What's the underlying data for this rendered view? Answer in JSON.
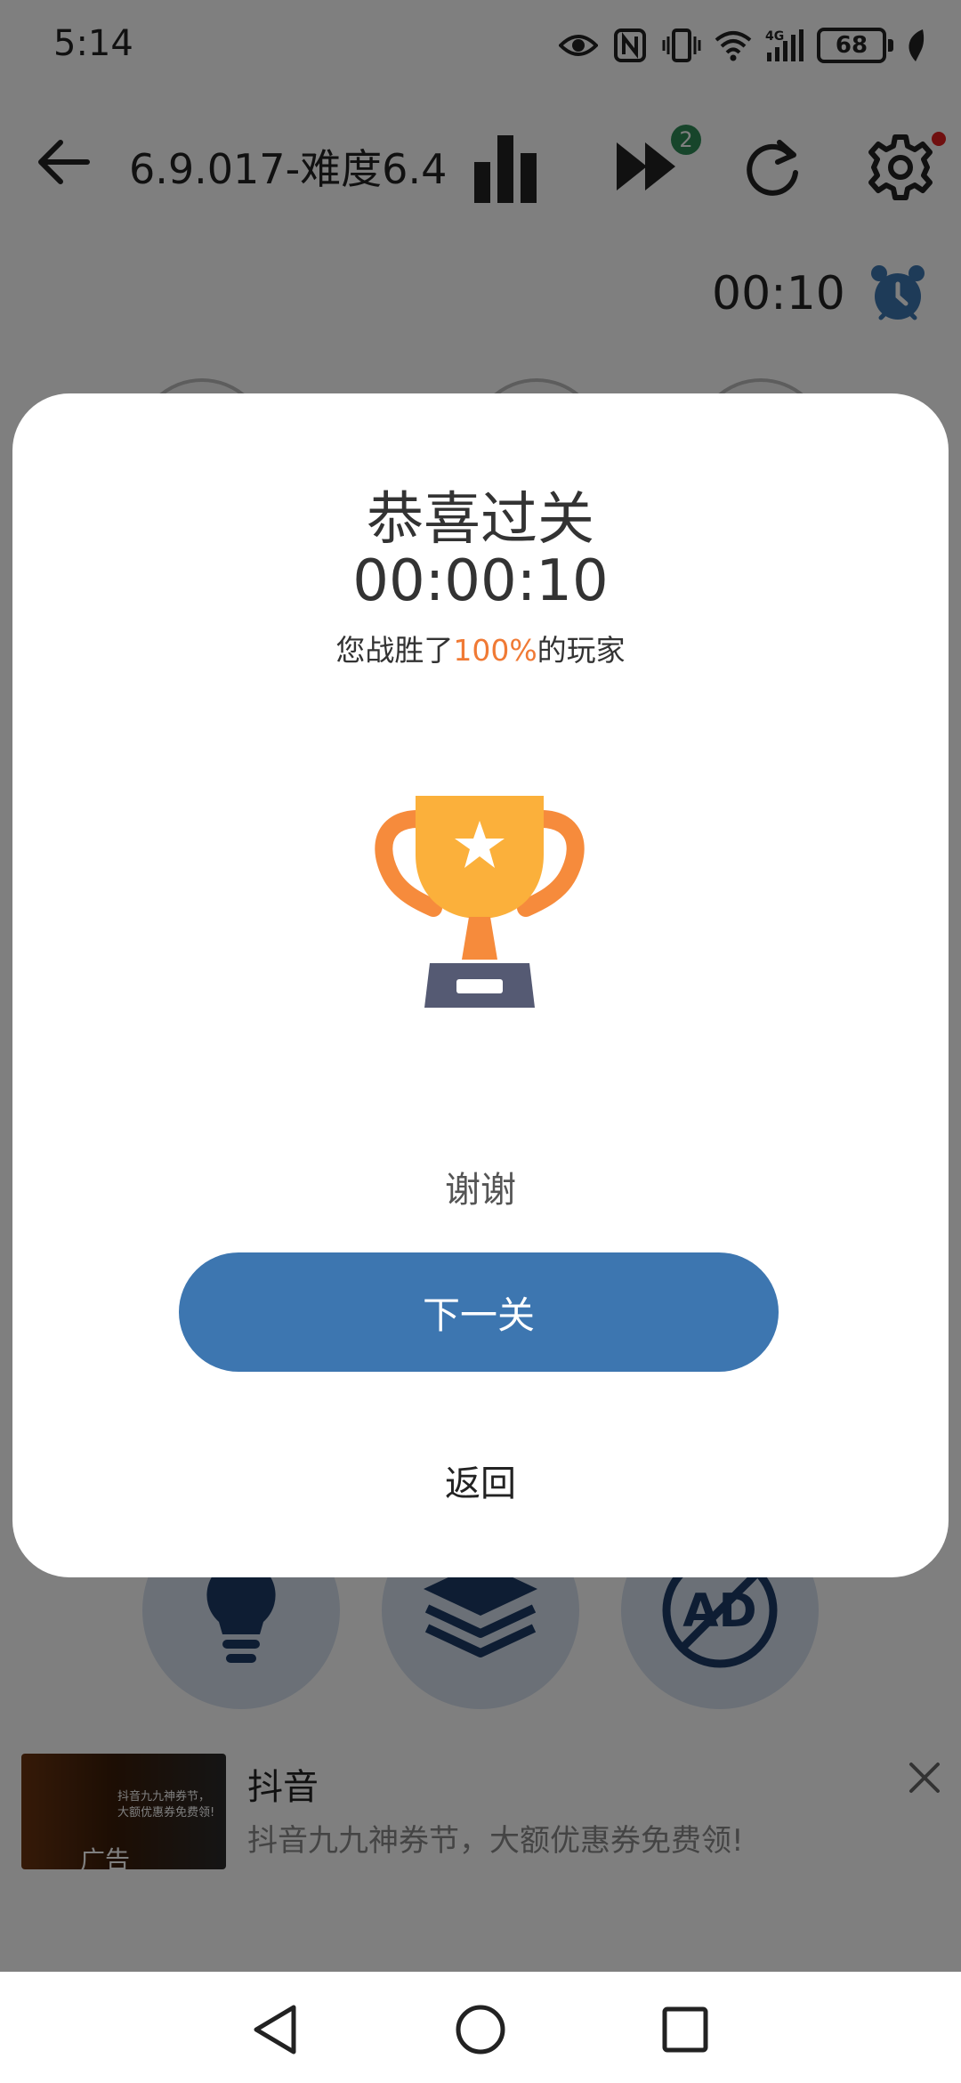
{
  "status_bar": {
    "time": "5:14",
    "battery": "68",
    "icons": [
      "eye-icon",
      "nfc-icon",
      "vibrate-icon",
      "wifi-icon",
      "signal-4g-icon",
      "battery-icon",
      "leaf-icon"
    ],
    "network_label": "4G"
  },
  "toolbar": {
    "title": "6.9.017-难度6.4",
    "skip_badge": "2",
    "icons": [
      "back-arrow-icon",
      "bar-chart-icon",
      "fast-forward-icon",
      "restart-icon",
      "gear-icon"
    ]
  },
  "timer": {
    "value": "00:10"
  },
  "dialog": {
    "title": "恭喜过关",
    "elapsed": "00:00:10",
    "beat_prefix": "您战胜了",
    "beat_percent": "100%",
    "beat_suffix": "的玩家",
    "thanks": "谢谢",
    "next_label": "下一关",
    "return_label": "返回"
  },
  "tools": {
    "icons": [
      "lightbulb-icon",
      "layers-icon",
      "no-ad-icon"
    ],
    "ad_icon_text": "AD"
  },
  "ad": {
    "title": "抖音",
    "subtitle": "抖音九九神券节，大额优惠券免费领!",
    "label": "广告",
    "thumb_text": "抖音九九神券节，大额优惠券免费领!"
  },
  "colors": {
    "accent": "#3d76b0",
    "highlight": "#f07a35",
    "trophy_cup": "#fbb03b",
    "trophy_handles": "#f68b3c",
    "trophy_base": "#555a73",
    "badge": "#2e8b57"
  }
}
